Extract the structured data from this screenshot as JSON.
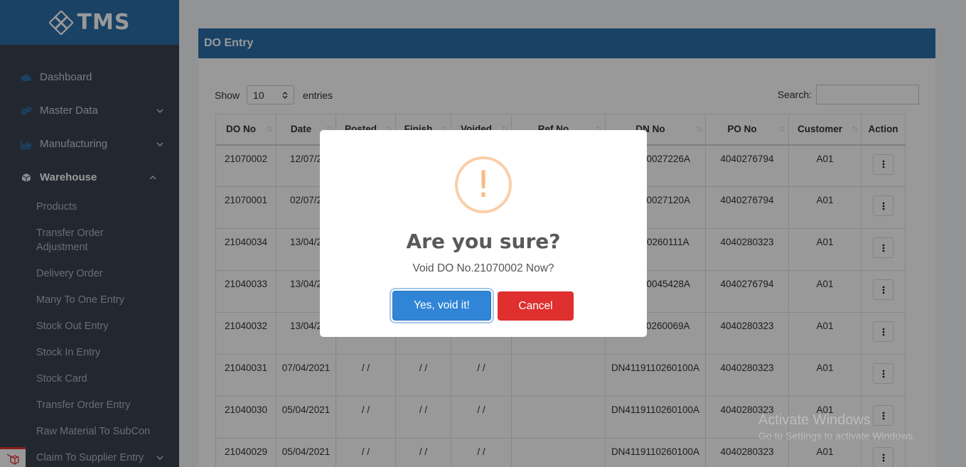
{
  "brand": {
    "name": "TMS"
  },
  "sidebar": {
    "items": [
      {
        "label": "Dashboard",
        "icon": "cloud-icon",
        "has_chevron": false
      },
      {
        "label": "Master Data",
        "icon": "cogs-icon",
        "has_chevron": true
      },
      {
        "label": "Manufacturing",
        "icon": "chart-icon",
        "has_chevron": true
      },
      {
        "label": "Warehouse",
        "icon": "cube-icon",
        "has_chevron": true,
        "active": true
      }
    ],
    "warehouse_sub": [
      "Products",
      "Transfer Order Adjustment",
      "Delivery Order",
      "Many To One Entry",
      "Stock Out Entry",
      "Stock In Entry",
      "Stock Card",
      "Transfer Order Entry",
      "Raw Material To SubCon",
      "Claim To Supplier Entry"
    ]
  },
  "card": {
    "title": "DO Entry",
    "show_label": "Show",
    "entries_value": "10",
    "entries_label": "entries",
    "search_label": "Search:"
  },
  "table": {
    "headers": [
      "DO No",
      "Date",
      "Posted",
      "Finish",
      "Voided",
      "Ref No",
      "DN No",
      "PO No",
      "Customer",
      "Action"
    ],
    "rows": [
      [
        "21070002",
        "12/07/2",
        "",
        "",
        "",
        "",
        "119090027226A",
        "4040276794",
        "A01"
      ],
      [
        "21070001",
        "02/07/2",
        "",
        "",
        "",
        "",
        "119090027120A",
        "4040276794",
        "A01"
      ],
      [
        "21040034",
        "13/04/2",
        "",
        "",
        "",
        "",
        "119110260111A",
        "4040280323",
        "A01"
      ],
      [
        "21040033",
        "13/04/2",
        "",
        "",
        "",
        "",
        "119090045428A",
        "4040276794",
        "A01"
      ],
      [
        "21040032",
        "13/04/2",
        "",
        "",
        "",
        "",
        "119110260069A",
        "4040280323",
        "A01"
      ],
      [
        "21040031",
        "07/04/2021",
        "/ /",
        "/ /",
        "/ /",
        "",
        "DN4119110260100A",
        "4040280323",
        "A01"
      ],
      [
        "21040030",
        "05/04/2021",
        "/ /",
        "/ /",
        "/ /",
        "",
        "DN4119110260100A",
        "4040280323",
        "A01"
      ],
      [
        "21040029",
        "05/04/2021",
        "/ /",
        "/ /",
        "/ /",
        "",
        "DN4119110260100A",
        "4040280323",
        "A01"
      ]
    ]
  },
  "dialog": {
    "icon": "warning-icon",
    "icon_glyph": "!",
    "title": "Are you sure?",
    "text": "Void DO No.21070002 Now?",
    "confirm_label": "Yes, void it!",
    "cancel_label": "Cancel"
  },
  "watermark": {
    "line1": "Activate Windows",
    "line2": "Go to Settings to activate Windows."
  },
  "colors": {
    "brand": "#2a6fa8",
    "sidebar": "#3b4351",
    "confirm": "#3085d6",
    "cancel": "#e02f2f",
    "warning": "#f8bb86"
  }
}
